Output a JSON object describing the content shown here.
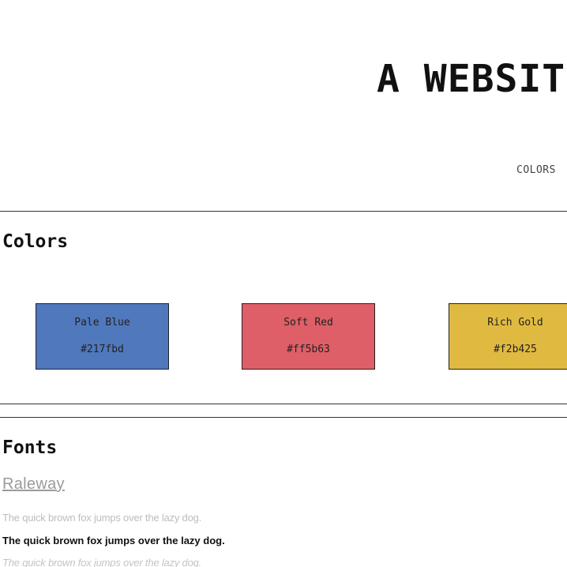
{
  "header": {
    "site_title": "A WEBSITE",
    "nav": [
      {
        "label": "COLORS"
      }
    ]
  },
  "colors_section": {
    "heading": "Colors",
    "swatches": [
      {
        "name": "Pale Blue",
        "hex_label": "#217fbd",
        "display_color": "#5078bc"
      },
      {
        "name": "Soft Red",
        "hex_label": "#ff5b63",
        "display_color": "#de5f67"
      },
      {
        "name": "Rich Gold",
        "hex_label": "#f2b425",
        "display_color": "#e0ba40"
      }
    ]
  },
  "fonts_section": {
    "heading": "Fonts",
    "font_name": "Raleway",
    "samples": [
      {
        "text": "The quick brown fox jumps over the lazy dog.",
        "style": "light"
      },
      {
        "text": "The quick brown fox jumps over the lazy dog.",
        "style": "bold"
      },
      {
        "text": "The quick brown fox jumps over the lazy dog.",
        "style": "italic"
      }
    ]
  }
}
